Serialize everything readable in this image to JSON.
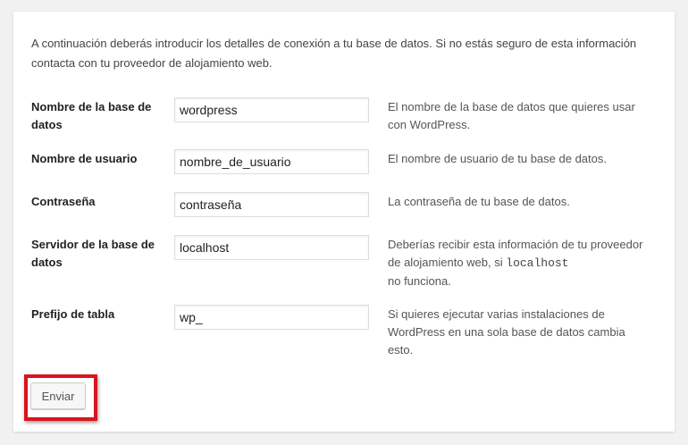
{
  "intro": "A continuación deberás introducir los detalles de conexión a tu base de datos. Si no estás seguro de esta información contacta con tu proveedor de alojamiento web.",
  "fields": {
    "dbname": {
      "label": "Nombre de la base de datos",
      "value": "wordpress",
      "description": "El nombre de la base de datos que quieres usar con WordPress."
    },
    "username": {
      "label": "Nombre de usuario",
      "value": "nombre_de_usuario",
      "description": "El nombre de usuario de tu base de datos."
    },
    "password": {
      "label": "Contraseña",
      "value": "contraseña",
      "description": "La contraseña de tu base de datos."
    },
    "dbhost": {
      "label": "Servidor de la base de datos",
      "value": "localhost",
      "description_before": "Deberías recibir esta información de tu proveedor de alojamiento web, si",
      "description_code": "localhost",
      "description_after": "no funciona."
    },
    "prefix": {
      "label": "Prefijo de tabla",
      "value": "wp_",
      "description": "Si quieres ejecutar varias instalaciones de WordPress en una sola base de datos cambia esto."
    }
  },
  "submit_label": "Enviar",
  "colors": {
    "highlight_border": "#d9141b",
    "background": "#f1f1f1",
    "panel": "#ffffff"
  }
}
